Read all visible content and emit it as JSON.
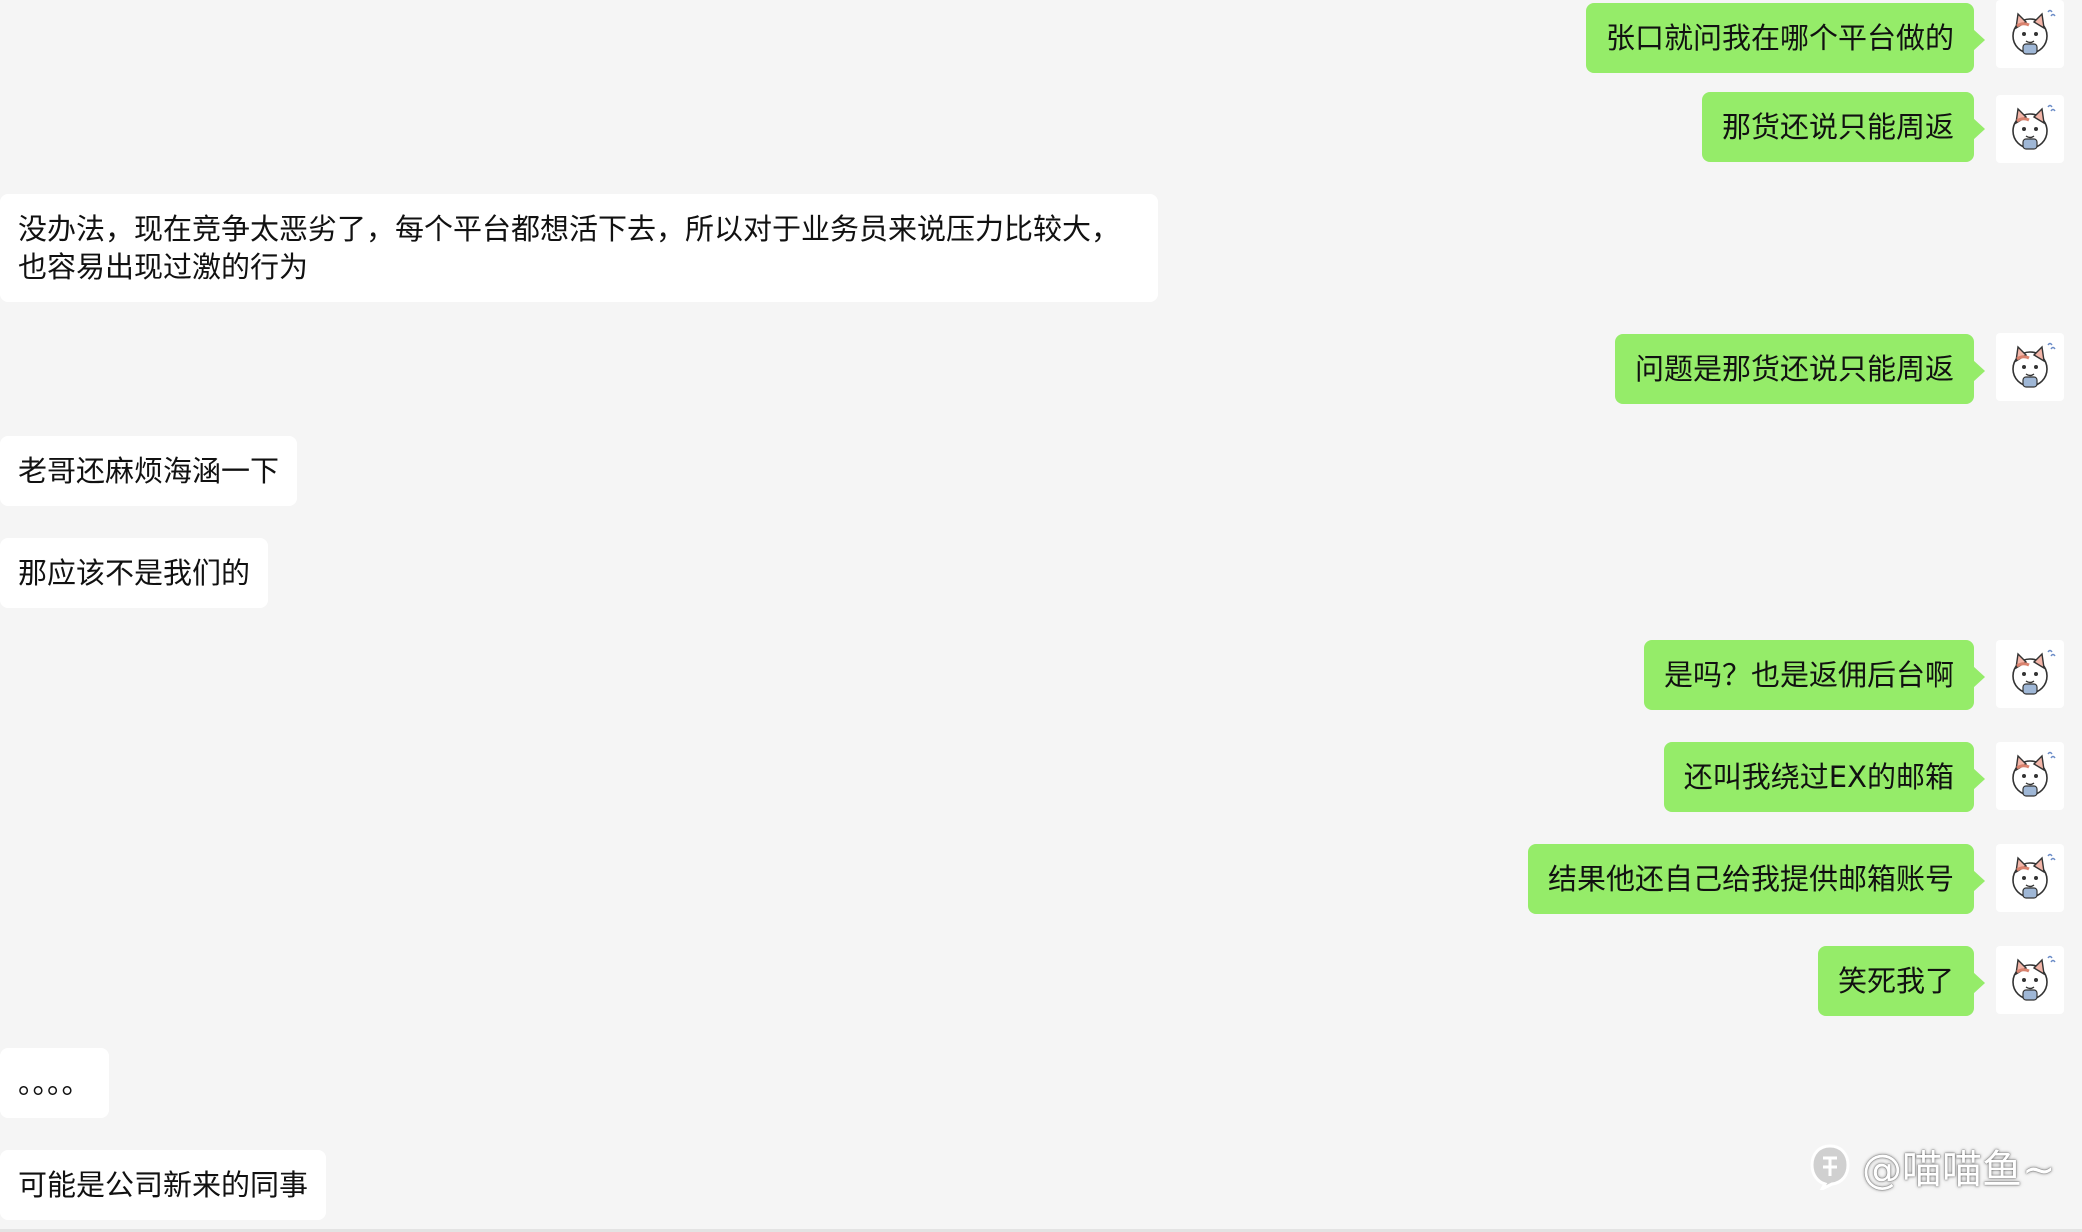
{
  "messages": [
    {
      "side": "out",
      "text": "张口就问我在哪个平台做的"
    },
    {
      "side": "out",
      "text": "那货还说只能周返"
    },
    {
      "side": "in",
      "text": "没办法，现在竞争太恶劣了，每个平台都想活下去，所以对于业务员来说压力比较大，也容易出现过激的行为"
    },
    {
      "side": "out",
      "text": "问题是那货还说只能周返"
    },
    {
      "side": "in",
      "text": "老哥还麻烦海涵一下"
    },
    {
      "side": "in",
      "text": "那应该不是我们的"
    },
    {
      "side": "out",
      "text": "是吗？也是返佣后台啊"
    },
    {
      "side": "out",
      "text": "还叫我绕过EX的邮箱"
    },
    {
      "side": "out",
      "text": "结果他还自己给我提供邮箱账号"
    },
    {
      "side": "out",
      "text": "笑死我了"
    },
    {
      "side": "in",
      "text": "。。。。"
    },
    {
      "side": "in",
      "text": "可能是公司新来的同事"
    }
  ],
  "avatar": {
    "icon": "cat-sticker-avatar-icon"
  },
  "watermark": {
    "logo": "zhihu-logo-icon",
    "text": "@喵喵鱼~"
  },
  "colors": {
    "background": "#f5f5f5",
    "outgoing_bubble": "#95ec69",
    "incoming_bubble": "#ffffff",
    "text": "#111111"
  }
}
